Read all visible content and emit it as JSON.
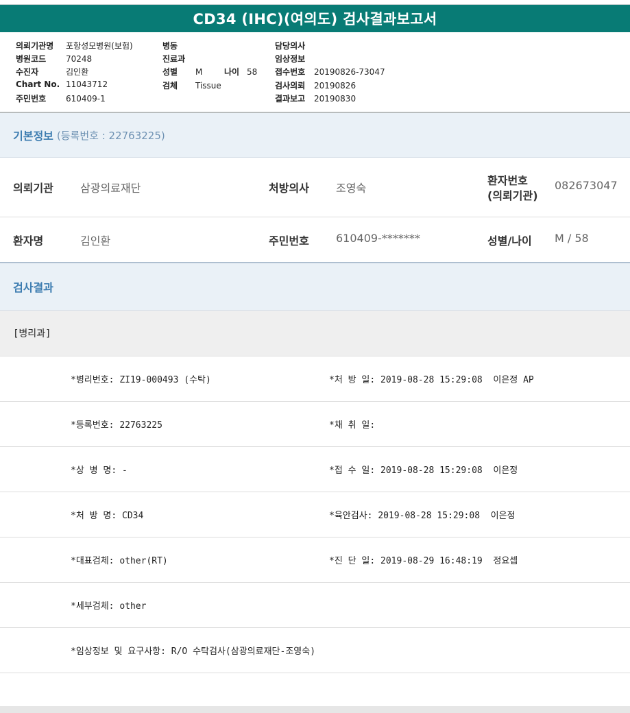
{
  "report": {
    "title": "CD34 (IHC)(여의도) 검사결과보고서"
  },
  "header": {
    "col1": [
      {
        "key": "의뢰기관명",
        "value": "포항성모병원(보험)"
      },
      {
        "key": "병원코드",
        "value": "70248"
      },
      {
        "key": "수진자",
        "value": "김인환"
      },
      {
        "key": "Chart No.",
        "value": "11043712"
      },
      {
        "key": "주민번호",
        "value": "610409-1"
      }
    ],
    "col2": [
      {
        "key": "병동",
        "value": ""
      },
      {
        "key": "진료과",
        "value": ""
      },
      {
        "key": "성별",
        "value": "M"
      },
      {
        "key": "검체",
        "value": "Tissue"
      }
    ],
    "age_key": "나이",
    "age_value": "58",
    "col3": [
      {
        "key": "담당의사",
        "value": ""
      },
      {
        "key": "임상정보",
        "value": ""
      },
      {
        "key": "접수번호",
        "value": "20190826-73047"
      },
      {
        "key": "검사의뢰",
        "value": "20190826"
      },
      {
        "key": "결과보고",
        "value": "20190830"
      }
    ]
  },
  "basic_info": {
    "section_title": "기본정보",
    "reg_label": "(등록번호 : 22763225)",
    "row1": {
      "k1": "의뢰기관",
      "v1": "삼광의료재단",
      "k2": "처방의사",
      "v2": "조영숙",
      "k3_line1": "환자번호",
      "k3_line2": "(의뢰기관)",
      "v3": "082673047"
    },
    "row2": {
      "k1": "환자명",
      "v1": "김인환",
      "k2": "주민번호",
      "v2": "610409-*******",
      "k3": "성별/나이",
      "v3": "M / 58"
    }
  },
  "results": {
    "section_title": "검사결과",
    "department": "[병리과]",
    "rows": [
      {
        "left": "*병리번호: ZI19-000493 (수탁)",
        "right": "*처 방 일: 2019-08-28 15:29:08  이은정 AP"
      },
      {
        "left": "*등록번호: 22763225",
        "right": "*채 취 일:"
      },
      {
        "left": "*상 병 명: -",
        "right": "*접 수 일: 2019-08-28 15:29:08  이은정"
      },
      {
        "left": "*처 방 명: CD34",
        "right": "*육안검사: 2019-08-28 15:29:08  이은정"
      },
      {
        "left": "*대표검체: other(RT)",
        "right": "*진 단 일: 2019-08-29 16:48:19  정요셉"
      },
      {
        "left": "*세부검체: other",
        "right": ""
      },
      {
        "left": "*임상정보 및 요구사항: R/O 수탁검사(삼광의료재단-조영숙)",
        "right": ""
      }
    ]
  }
}
